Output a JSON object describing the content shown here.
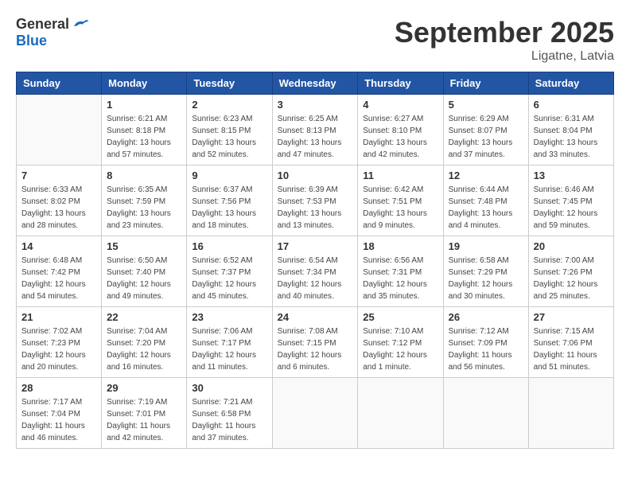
{
  "header": {
    "logo": {
      "general": "General",
      "blue": "Blue"
    },
    "title": "September 2025",
    "location": "Ligatne, Latvia"
  },
  "columns": [
    "Sunday",
    "Monday",
    "Tuesday",
    "Wednesday",
    "Thursday",
    "Friday",
    "Saturday"
  ],
  "weeks": [
    [
      {
        "day": "",
        "info": ""
      },
      {
        "day": "1",
        "info": "Sunrise: 6:21 AM\nSunset: 8:18 PM\nDaylight: 13 hours\nand 57 minutes."
      },
      {
        "day": "2",
        "info": "Sunrise: 6:23 AM\nSunset: 8:15 PM\nDaylight: 13 hours\nand 52 minutes."
      },
      {
        "day": "3",
        "info": "Sunrise: 6:25 AM\nSunset: 8:13 PM\nDaylight: 13 hours\nand 47 minutes."
      },
      {
        "day": "4",
        "info": "Sunrise: 6:27 AM\nSunset: 8:10 PM\nDaylight: 13 hours\nand 42 minutes."
      },
      {
        "day": "5",
        "info": "Sunrise: 6:29 AM\nSunset: 8:07 PM\nDaylight: 13 hours\nand 37 minutes."
      },
      {
        "day": "6",
        "info": "Sunrise: 6:31 AM\nSunset: 8:04 PM\nDaylight: 13 hours\nand 33 minutes."
      }
    ],
    [
      {
        "day": "7",
        "info": "Sunrise: 6:33 AM\nSunset: 8:02 PM\nDaylight: 13 hours\nand 28 minutes."
      },
      {
        "day": "8",
        "info": "Sunrise: 6:35 AM\nSunset: 7:59 PM\nDaylight: 13 hours\nand 23 minutes."
      },
      {
        "day": "9",
        "info": "Sunrise: 6:37 AM\nSunset: 7:56 PM\nDaylight: 13 hours\nand 18 minutes."
      },
      {
        "day": "10",
        "info": "Sunrise: 6:39 AM\nSunset: 7:53 PM\nDaylight: 13 hours\nand 13 minutes."
      },
      {
        "day": "11",
        "info": "Sunrise: 6:42 AM\nSunset: 7:51 PM\nDaylight: 13 hours\nand 9 minutes."
      },
      {
        "day": "12",
        "info": "Sunrise: 6:44 AM\nSunset: 7:48 PM\nDaylight: 13 hours\nand 4 minutes."
      },
      {
        "day": "13",
        "info": "Sunrise: 6:46 AM\nSunset: 7:45 PM\nDaylight: 12 hours\nand 59 minutes."
      }
    ],
    [
      {
        "day": "14",
        "info": "Sunrise: 6:48 AM\nSunset: 7:42 PM\nDaylight: 12 hours\nand 54 minutes."
      },
      {
        "day": "15",
        "info": "Sunrise: 6:50 AM\nSunset: 7:40 PM\nDaylight: 12 hours\nand 49 minutes."
      },
      {
        "day": "16",
        "info": "Sunrise: 6:52 AM\nSunset: 7:37 PM\nDaylight: 12 hours\nand 45 minutes."
      },
      {
        "day": "17",
        "info": "Sunrise: 6:54 AM\nSunset: 7:34 PM\nDaylight: 12 hours\nand 40 minutes."
      },
      {
        "day": "18",
        "info": "Sunrise: 6:56 AM\nSunset: 7:31 PM\nDaylight: 12 hours\nand 35 minutes."
      },
      {
        "day": "19",
        "info": "Sunrise: 6:58 AM\nSunset: 7:29 PM\nDaylight: 12 hours\nand 30 minutes."
      },
      {
        "day": "20",
        "info": "Sunrise: 7:00 AM\nSunset: 7:26 PM\nDaylight: 12 hours\nand 25 minutes."
      }
    ],
    [
      {
        "day": "21",
        "info": "Sunrise: 7:02 AM\nSunset: 7:23 PM\nDaylight: 12 hours\nand 20 minutes."
      },
      {
        "day": "22",
        "info": "Sunrise: 7:04 AM\nSunset: 7:20 PM\nDaylight: 12 hours\nand 16 minutes."
      },
      {
        "day": "23",
        "info": "Sunrise: 7:06 AM\nSunset: 7:17 PM\nDaylight: 12 hours\nand 11 minutes."
      },
      {
        "day": "24",
        "info": "Sunrise: 7:08 AM\nSunset: 7:15 PM\nDaylight: 12 hours\nand 6 minutes."
      },
      {
        "day": "25",
        "info": "Sunrise: 7:10 AM\nSunset: 7:12 PM\nDaylight: 12 hours\nand 1 minute."
      },
      {
        "day": "26",
        "info": "Sunrise: 7:12 AM\nSunset: 7:09 PM\nDaylight: 11 hours\nand 56 minutes."
      },
      {
        "day": "27",
        "info": "Sunrise: 7:15 AM\nSunset: 7:06 PM\nDaylight: 11 hours\nand 51 minutes."
      }
    ],
    [
      {
        "day": "28",
        "info": "Sunrise: 7:17 AM\nSunset: 7:04 PM\nDaylight: 11 hours\nand 46 minutes."
      },
      {
        "day": "29",
        "info": "Sunrise: 7:19 AM\nSunset: 7:01 PM\nDaylight: 11 hours\nand 42 minutes."
      },
      {
        "day": "30",
        "info": "Sunrise: 7:21 AM\nSunset: 6:58 PM\nDaylight: 11 hours\nand 37 minutes."
      },
      {
        "day": "",
        "info": ""
      },
      {
        "day": "",
        "info": ""
      },
      {
        "day": "",
        "info": ""
      },
      {
        "day": "",
        "info": ""
      }
    ]
  ]
}
